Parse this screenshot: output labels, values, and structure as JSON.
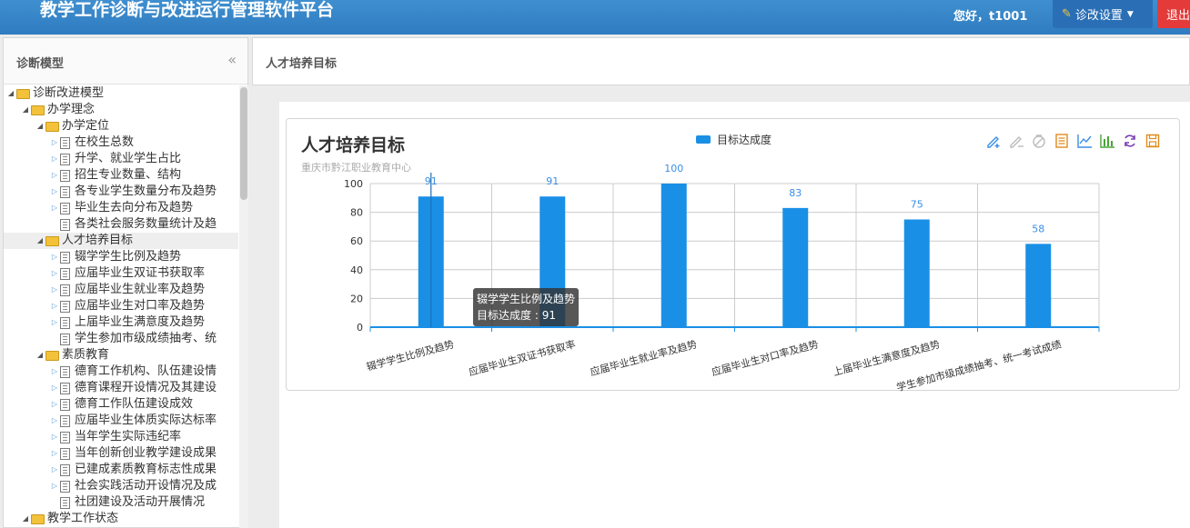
{
  "header": {
    "app_title": "教学工作诊断与改进运行管理软件平台",
    "greeting": "您好，t1001",
    "settings_label": "诊改设置",
    "logout_label": "退出",
    "brand_color": "#3f8fd0"
  },
  "sidebar": {
    "title": "诊断模型",
    "collapse_icon": "double-chevron-left-icon",
    "tree": [
      {
        "label": "诊断改进模型",
        "kind": "folder",
        "depth": 0,
        "expanded": true
      },
      {
        "label": "办学理念",
        "kind": "folder",
        "depth": 1,
        "expanded": true
      },
      {
        "label": "办学定位",
        "kind": "folder",
        "depth": 2,
        "expanded": true
      },
      {
        "label": "在校生总数",
        "kind": "file",
        "depth": 3
      },
      {
        "label": "升学、就业学生占比",
        "kind": "file",
        "depth": 3
      },
      {
        "label": "招生专业数量、结构",
        "kind": "file",
        "depth": 3
      },
      {
        "label": "各专业学生数量分布及趋势",
        "kind": "file",
        "depth": 3
      },
      {
        "label": "毕业生去向分布及趋势",
        "kind": "file",
        "depth": 3
      },
      {
        "label": "各类社会服务数量统计及趋",
        "kind": "file",
        "depth": 3,
        "leaf": true
      },
      {
        "label": "人才培养目标",
        "kind": "folder",
        "depth": 2,
        "expanded": true,
        "selected": true
      },
      {
        "label": "辍学学生比例及趋势",
        "kind": "file",
        "depth": 3
      },
      {
        "label": "应届毕业生双证书获取率",
        "kind": "file",
        "depth": 3
      },
      {
        "label": "应届毕业生就业率及趋势",
        "kind": "file",
        "depth": 3
      },
      {
        "label": "应届毕业生对口率及趋势",
        "kind": "file",
        "depth": 3
      },
      {
        "label": "上届毕业生满意度及趋势",
        "kind": "file",
        "depth": 3
      },
      {
        "label": "学生参加市级成绩抽考、统",
        "kind": "file",
        "depth": 3,
        "leaf": true
      },
      {
        "label": "素质教育",
        "kind": "folder",
        "depth": 2,
        "expanded": true
      },
      {
        "label": "德育工作机构、队伍建设情",
        "kind": "file",
        "depth": 3
      },
      {
        "label": "德育课程开设情况及其建设",
        "kind": "file",
        "depth": 3
      },
      {
        "label": "德育工作队伍建设成效",
        "kind": "file",
        "depth": 3
      },
      {
        "label": "应届毕业生体质实际达标率",
        "kind": "file",
        "depth": 3
      },
      {
        "label": "当年学生实际违纪率",
        "kind": "file",
        "depth": 3
      },
      {
        "label": "当年创新创业教学建设成果",
        "kind": "file",
        "depth": 3
      },
      {
        "label": "已建成素质教育标志性成果",
        "kind": "file",
        "depth": 3
      },
      {
        "label": "社会实践活动开设情况及成",
        "kind": "file",
        "depth": 3
      },
      {
        "label": "社团建设及活动开展情况",
        "kind": "file",
        "depth": 3,
        "leaf": true
      },
      {
        "label": "教学工作状态",
        "kind": "folder",
        "depth": 1,
        "expanded": true
      }
    ]
  },
  "main": {
    "breadcrumb_title": "人才培养目标"
  },
  "chart_panel": {
    "title": "人才培养目标",
    "subtitle": "重庆市黔江职业教育中心",
    "toolbox_icons": [
      "pencil-add-icon",
      "eraser-icon",
      "clear-icon",
      "data-view-icon",
      "line-chart-icon",
      "bar-chart-icon",
      "refresh-icon",
      "save-image-icon"
    ],
    "tooltip": {
      "title": "辍学学生比例及趋势",
      "series": "目标达成度",
      "value": "91"
    }
  },
  "chart_data": {
    "type": "bar",
    "categories": [
      "辍学学生比例及趋势",
      "应届毕业生双证书获取率",
      "应届毕业生就业率及趋势",
      "应届毕业生对口率及趋势",
      "上届毕业生满意度及趋势",
      "学生参加市级成绩抽考、统一考试成绩"
    ],
    "series": [
      {
        "name": "目标达成度",
        "values": [
          91,
          91,
          100,
          83,
          75,
          58
        ],
        "color": "#1a8fe6"
      }
    ],
    "yticks": [
      0,
      20,
      40,
      60,
      80,
      100
    ],
    "ylim": [
      0,
      100
    ],
    "grid": true,
    "legend_position": "top-center"
  }
}
